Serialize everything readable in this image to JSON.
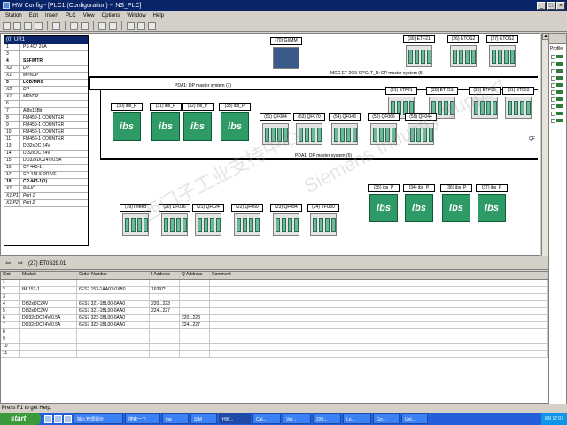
{
  "window": {
    "title": "HW Config - [PLC1 (Configuration) -- NS_PLC]",
    "controls": [
      "_",
      "□",
      "×"
    ]
  },
  "menu": [
    "Station",
    "Edit",
    "Insert",
    "PLC",
    "View",
    "Options",
    "Window",
    "Help"
  ],
  "rack": {
    "title": "(0) UR1",
    "rows": [
      {
        "slot": "1",
        "module": "PS 407 20A",
        "style": ""
      },
      {
        "slot": "3",
        "module": "",
        "style": ""
      },
      {
        "slot": "4",
        "module": "SSF/MTR",
        "style": "bold"
      },
      {
        "slot": "X2",
        "module": "DP",
        "style": "sub"
      },
      {
        "slot": "X1",
        "module": "MPI/DP",
        "style": "sub"
      },
      {
        "slot": "5",
        "module": "LCD/MRG",
        "style": "bold"
      },
      {
        "slot": "X2",
        "module": "DP",
        "style": "sub"
      },
      {
        "slot": "X1",
        "module": "MPI/DP",
        "style": "sub"
      },
      {
        "slot": "6",
        "module": "",
        "style": ""
      },
      {
        "slot": "7",
        "module": "AI8x16Bit",
        "style": ""
      },
      {
        "slot": "8",
        "module": "FM450-1 COUNTER",
        "style": ""
      },
      {
        "slot": "9",
        "module": "FM450-1 COUNTER",
        "style": ""
      },
      {
        "slot": "10",
        "module": "FM450-1 COUNTER",
        "style": ""
      },
      {
        "slot": "11",
        "module": "FM450-1 COUNTER",
        "style": ""
      },
      {
        "slot": "13",
        "module": "DI32xDC 24V",
        "style": ""
      },
      {
        "slot": "14",
        "module": "DI32xDC 24V",
        "style": ""
      },
      {
        "slot": "15",
        "module": "DO32xDC24V/0.5A",
        "style": ""
      },
      {
        "slot": "16",
        "module": "CP 443-1",
        "style": ""
      },
      {
        "slot": "17",
        "module": "CP 443-5 DRIVE",
        "style": ""
      },
      {
        "slot": "18",
        "module": "CP 443-1(1)",
        "style": "bold"
      },
      {
        "slot": "X1",
        "module": "PN-IO",
        "style": "sub"
      },
      {
        "slot": "X1 P1",
        "module": "Port 1",
        "style": "sub"
      },
      {
        "slot": "X1 P2",
        "module": "Port 2",
        "style": "sub"
      }
    ]
  },
  "network": {
    "bus_mcc": "MCC ET-200/ CPC/ T_R: DP master system (5)",
    "bus_pda7": "PDA1: DP master system (7)",
    "bus_pda6": "PDA1: DP master system (6)",
    "stations_top": [
      {
        "label": "(70) GI/MM",
        "kind": "drive"
      },
      {
        "label": "(30) ETF21",
        "kind": "io"
      },
      {
        "label": "(26) ETOS2",
        "kind": "io"
      },
      {
        "label": "(27) ETOS2",
        "kind": "io"
      },
      {
        "label": "(21) ETF21",
        "kind": "io"
      },
      {
        "label": "(28) ET OS",
        "kind": "io"
      },
      {
        "label": "(25) ETF38",
        "kind": "io"
      },
      {
        "label": "(31) ET053",
        "kind": "io"
      }
    ],
    "ibs_row1": [
      "(30) ibs_P",
      "(31) ibs_P",
      "(32) ibs_P",
      "(33) ibs_P"
    ],
    "io_row1": [
      "(51) QF084",
      "(53) QF070",
      "(54) QF048",
      "(52) QF066",
      "(55) QF044"
    ],
    "io_row2": [
      "(19) Infeed",
      "(20) DF016",
      "(21) QF024",
      "(22) QF060",
      "(23) QF084",
      "(24) VFU50"
    ],
    "ibs_row2": [
      "(35) ibs_P",
      "(34) ibs_P",
      "(36) ibs_P",
      "(37) ibs_P"
    ],
    "ibs_text": "ibs",
    "side_label": "QF"
  },
  "detail": {
    "header": "(27)   ET0S29.01",
    "columns": [
      "Slot",
      "Module",
      "Order Number",
      "I Address",
      "Q Address",
      "Comment"
    ],
    "rows": [
      [
        "1",
        "",
        "",
        "",
        "",
        ""
      ],
      [
        "2",
        "IM 153-1",
        "6ES7 153-1AA03-0XB0",
        "16397*",
        "",
        ""
      ],
      [
        "3",
        "",
        "",
        "",
        "",
        ""
      ],
      [
        "4",
        "DI32xDC24V",
        "6ES7 321-1BL00-0AA0",
        "220...223",
        "",
        ""
      ],
      [
        "5",
        "DI32xDC24V",
        "6ES7 321-1BL00-0AA0",
        "224...227",
        "",
        ""
      ],
      [
        "6",
        "DO32xDC24V/0.5A",
        "6ES7 322-1BL00-0AA0",
        "",
        "220...223",
        ""
      ],
      [
        "7",
        "DO32xDC24V/0.5A",
        "6ES7 322-1BL00-0AA0",
        "",
        "224...227",
        ""
      ],
      [
        "8",
        "",
        "",
        "",
        "",
        ""
      ],
      [
        "9",
        "",
        "",
        "",
        "",
        ""
      ],
      [
        "10",
        "",
        "",
        "",
        "",
        ""
      ],
      [
        "11",
        "",
        "",
        "",
        "",
        ""
      ]
    ]
  },
  "catalog": {
    "profile_label": "Profile"
  },
  "status": "Press F1 to get Help.",
  "taskbar": {
    "start": "start",
    "tasks": [
      "输入管理报价",
      "搜索一下",
      "iba",
      "SIM",
      "HW...",
      "Cal...",
      "Var...",
      "220...",
      "Lo...",
      "Go...",
      "Unt..."
    ],
    "clock": "EN 17:07"
  },
  "colors": {
    "titlebar": "#0a246a",
    "taskbar": "#245edb",
    "ibs_green": "#2e9a66",
    "bus_black": "#000000"
  }
}
